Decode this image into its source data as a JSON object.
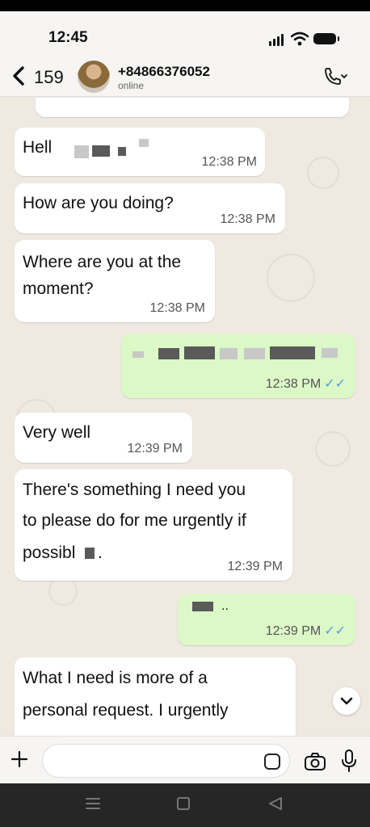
{
  "status_bar": {
    "time": "12:45"
  },
  "header": {
    "back_count": "159",
    "contact_name": "+84866376052",
    "contact_status": "online"
  },
  "messages": [
    {
      "text": "Hell",
      "time": "12:38 PM",
      "direction": "in"
    },
    {
      "text": "How are you doing?",
      "time": "12:38 PM",
      "direction": "in"
    },
    {
      "text_line1": "Where are you at the",
      "text_line2": "moment?",
      "time": "12:38 PM",
      "direction": "in"
    },
    {
      "text": "",
      "time": "12:38 PM",
      "direction": "out",
      "read": true
    },
    {
      "text": "Very well",
      "time": "12:39 PM",
      "direction": "in"
    },
    {
      "text_line1": "There's something I need you",
      "text_line2": "to please do for me urgently if",
      "text_line3": "possibl",
      "text_suffix": ".",
      "time": "12:39 PM",
      "direction": "in"
    },
    {
      "text": "..",
      "time": "12:39 PM",
      "direction": "out",
      "read": true
    },
    {
      "text_line1": "What I need is more of a",
      "text_line2": "personal request. I urgently",
      "direction": "in"
    }
  ],
  "icons": {
    "back": "chevron-left-icon",
    "call": "phone-icon",
    "scroll_down": "chevron-down-icon",
    "attach": "plus-icon",
    "sticker": "sticker-icon",
    "camera": "camera-icon",
    "mic": "microphone-icon",
    "read_receipt": "double-check-icon"
  },
  "colors": {
    "incoming_bubble": "#ffffff",
    "outgoing_bubble": "#dcf8c6",
    "read_tick": "#4aa3df",
    "chat_background": "#efe9e1"
  }
}
